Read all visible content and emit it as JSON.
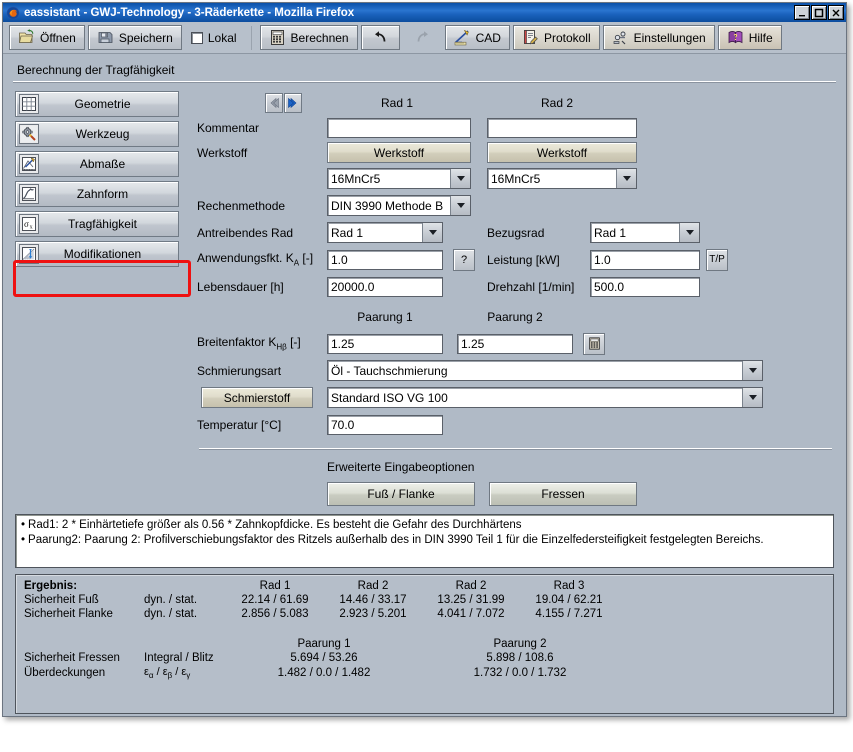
{
  "window": {
    "title": "eassistant - GWJ-Technology - 3-Räderkette - Mozilla Firefox",
    "app_icon": "firefox-icon",
    "minimize_label": "_",
    "maximize_label": "□",
    "close_label": "X"
  },
  "toolbar": {
    "buttons": [
      {
        "label": "Öffnen",
        "icon": "open-folder-icon"
      },
      {
        "label": "Speichern",
        "icon": "floppy-disk-icon"
      }
    ],
    "lokal": {
      "label": "Lokal",
      "checked": false
    },
    "berechnen": {
      "label": "Berechnen",
      "icon": "calculator-icon"
    },
    "undo": {
      "label": "",
      "icon": "undo-arrow-icon",
      "enabled": true
    },
    "redo": {
      "label": "",
      "icon": "redo-arrow-icon",
      "enabled": false
    },
    "cad": {
      "label": "CAD",
      "icon": "cad-pencil-icon"
    },
    "protokoll": {
      "label": "Protokoll",
      "icon": "report-icon"
    },
    "einstellungen": {
      "label": "Einstellungen",
      "icon": "settings-icon"
    },
    "hilfe": {
      "label": "Hilfe",
      "icon": "help-book-icon"
    }
  },
  "section": {
    "title": "Berechnung der Tragfähigkeit"
  },
  "sidebar": {
    "items": [
      {
        "label": "Geometrie",
        "icon": "grid-icon"
      },
      {
        "label": "Werkzeug",
        "icon": "gear-tool-icon"
      },
      {
        "label": "Abmaße",
        "icon": "measure-icon"
      },
      {
        "label": "Zahnform",
        "icon": "tooth-profile-icon"
      },
      {
        "label": "Tragfähigkeit",
        "icon": "sigma-x-icon",
        "selected": true
      },
      {
        "label": "Modifikationen",
        "icon": "modifications-icon"
      }
    ]
  },
  "form": {
    "nav": {
      "prev": "prev-arrow",
      "next": "next-arrow"
    },
    "columns": {
      "rad1": "Rad 1",
      "rad2": "Rad 2"
    },
    "kommentar": {
      "label": "Kommentar",
      "rad1": "",
      "rad2": "",
      "placeholder": ""
    },
    "werkstoff": {
      "label": "Werkstoff",
      "button_label": "Werkstoff",
      "rad1_value": "16MnCr5",
      "rad2_value": "16MnCr5"
    },
    "rechenmethode": {
      "label": "Rechenmethode",
      "value": "DIN 3990 Methode B"
    },
    "antreibendes_rad": {
      "label": "Antreibendes Rad",
      "value": "Rad 1"
    },
    "bezugsrad": {
      "label": "Bezugsrad",
      "value": "Rad 1"
    },
    "anwendungsfkt": {
      "label": "Anwendungsfkt. K",
      "sub": "A",
      "unit": " [-]",
      "value": "1.0",
      "help": "?"
    },
    "leistung": {
      "label": "Leistung [kW]",
      "value": "1.0",
      "tp_button": "T/P"
    },
    "lebensdauer": {
      "label": "Lebensdauer [h]",
      "value": "20000.0"
    },
    "drehzahl": {
      "label": "Drehzahl [1/min]",
      "value": "500.0"
    },
    "paarung_headers": {
      "p1": "Paarung 1",
      "p2": "Paarung 2"
    },
    "breitenfaktor": {
      "label": "Breitenfaktor K",
      "sub": "Hβ",
      "unit": " [-]",
      "p1": "1.25",
      "p2": "1.25",
      "calc_icon": "calculator-icon"
    },
    "schmierungsart": {
      "label": "Schmierungsart",
      "value": "Öl - Tauchschmierung"
    },
    "schmierstoff": {
      "label": "Schmierstoff",
      "value": "Standard ISO VG 100"
    },
    "temperatur": {
      "label": "Temperatur [°C]",
      "value": "70.0"
    },
    "erweiterte": {
      "title": "Erweiterte Eingabeoptionen",
      "fuss_flanke": "Fuß / Flanke",
      "fressen": "Fressen"
    }
  },
  "messages": [
    "Rad1: 2 * Einhärtetiefe größer als 0.56 * Zahnkopfdicke. Es besteht die Gefahr des Durchhärtens",
    "Paarung2: Paarung 2: Profilverschiebungsfaktor des Ritzels außerhalb des in DIN 3990 Teil 1 für die Einzelfedersteifigkeit festgelegten Bereichs."
  ],
  "result": {
    "title": "Ergebnis:",
    "wheel_headers": [
      "Rad 1",
      "Rad 2",
      "Rad 2",
      "Rad 3"
    ],
    "rows": [
      {
        "label": "Sicherheit Fuß",
        "sub": "dyn. / stat.",
        "values": [
          "22.14  /  61.69",
          "14.46  /  33.17",
          "13.25  /  31.99",
          "19.04  /  62.21"
        ]
      },
      {
        "label": "Sicherheit Flanke",
        "sub": "dyn. / stat.",
        "values": [
          "2.856  /  5.083",
          "2.923  /  5.201",
          "4.041  /  7.072",
          "4.155  /  7.271"
        ]
      }
    ],
    "pair_headers": [
      "Paarung 1",
      "Paarung 2"
    ],
    "pair_rows": [
      {
        "label": "Sicherheit Fressen",
        "sub": "Integral / Blitz",
        "values": [
          "5.694    /    53.26",
          "5.898    /    108.6"
        ]
      },
      {
        "label": "Überdeckungen",
        "sub_eps": true,
        "values": [
          "1.482 /   0.0   / 1.482",
          "1.732 /   0.0   / 1.732"
        ]
      }
    ]
  },
  "colors": {
    "window_bg": "#b0bac6",
    "titlebar": "#1a62bd",
    "annotation": "#ee1111",
    "field_bg": "#ffffff"
  }
}
